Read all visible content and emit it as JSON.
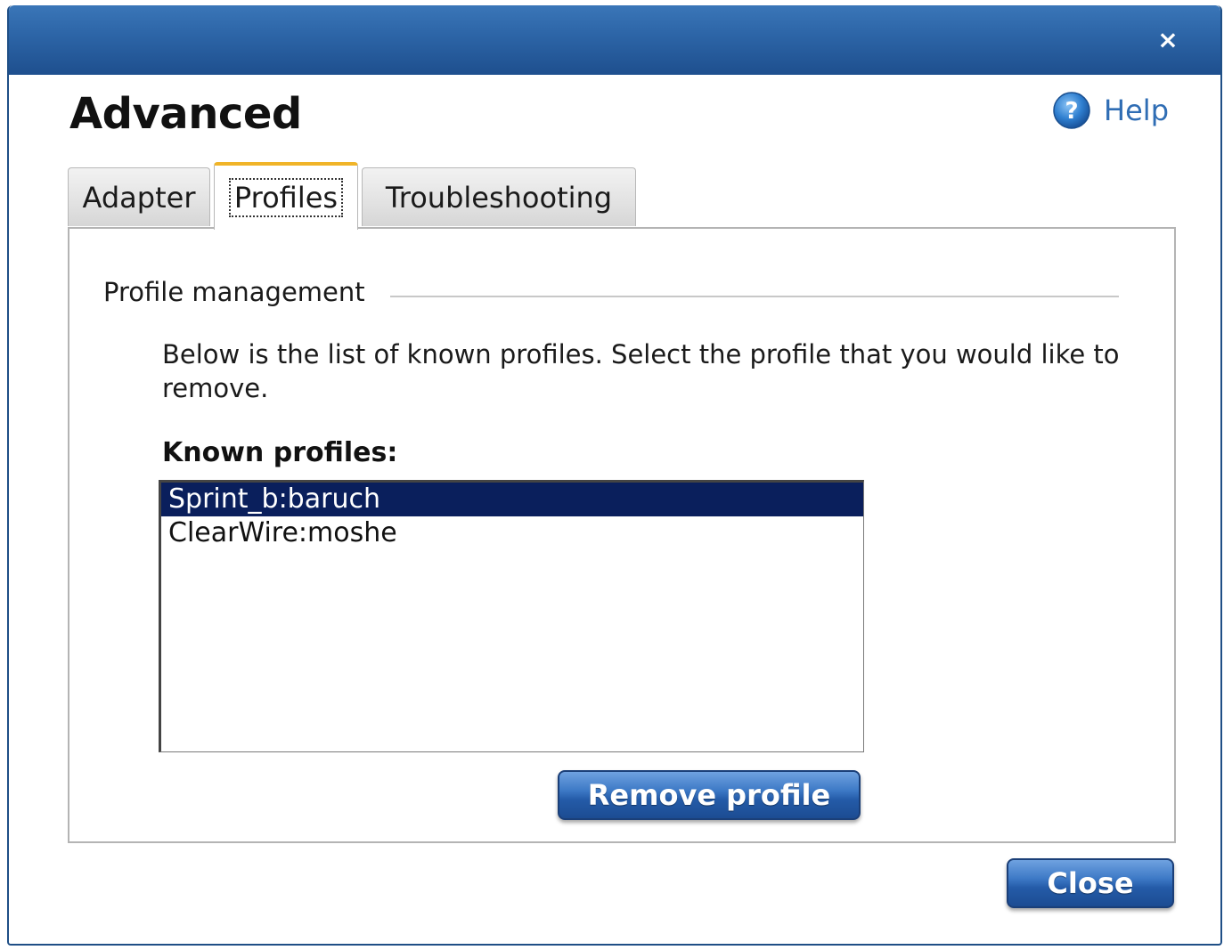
{
  "window": {
    "close_glyph": "×",
    "title": "Advanced"
  },
  "help": {
    "label": "Help",
    "icon": "help-question-icon"
  },
  "tabs": [
    {
      "label": "Adapter",
      "active": false
    },
    {
      "label": "Profiles",
      "active": true
    },
    {
      "label": "Troubleshooting",
      "active": false
    }
  ],
  "profile_management": {
    "section_title": "Profile management",
    "description": "Below is the list of known profiles.  Select the profile that you would like to remove.",
    "list_label": "Known profiles:",
    "profiles": [
      {
        "name": "Sprint_b:baruch",
        "selected": true
      },
      {
        "name": "ClearWire:moshe",
        "selected": false
      }
    ],
    "remove_button_label": "Remove profile"
  },
  "footer": {
    "close_button_label": "Close"
  },
  "colors": {
    "titlebar": "#2c64a6",
    "active_tab_accent": "#f0b429",
    "selection": "#0a1f5c",
    "button": "#245ba8",
    "help_text": "#2f6db4"
  }
}
